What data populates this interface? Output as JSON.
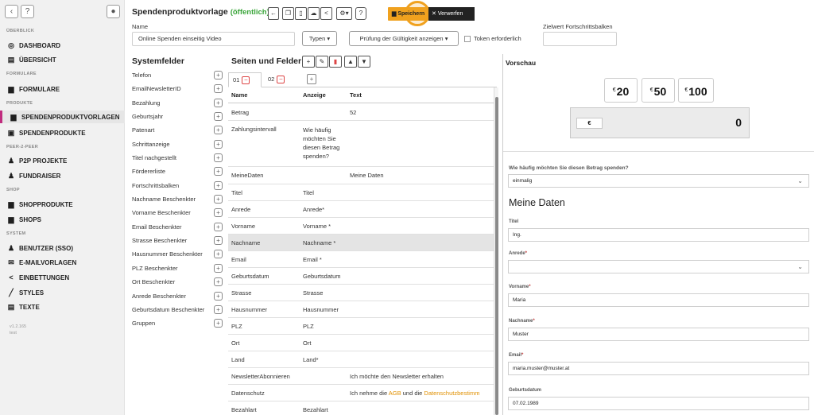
{
  "sidebar": {
    "sections": [
      {
        "label": "ÜBERBLICK"
      },
      {
        "label": "FORMULARE"
      },
      {
        "label": "PRODUKTE"
      },
      {
        "label": "PEER-2-PEER"
      },
      {
        "label": "SHOP"
      },
      {
        "label": "SYSTEM"
      }
    ],
    "items": [
      {
        "label": "DASHBOARD",
        "icon": "dashboard-icon"
      },
      {
        "label": "ÜBERSICHT",
        "icon": "overview-icon"
      },
      {
        "label": "FORMULARE",
        "icon": "form-icon"
      },
      {
        "label": "SPENDENPRODUKTVORLAGEN",
        "icon": "template-icon"
      },
      {
        "label": "SPENDENPRODUKTE",
        "icon": "gift-icon"
      },
      {
        "label": "P2P PROJEKTE",
        "icon": "users-icon"
      },
      {
        "label": "FUNDRAISER",
        "icon": "group-icon"
      },
      {
        "label": "SHOPPRODUKTE",
        "icon": "shop-product-icon"
      },
      {
        "label": "SHOPS",
        "icon": "shop-icon"
      },
      {
        "label": "BENUTZER (SSO)",
        "icon": "group-icon"
      },
      {
        "label": "E-MAILVORLAGEN",
        "icon": "mail-icon"
      },
      {
        "label": "EINBETTUNGEN",
        "icon": "share-icon"
      },
      {
        "label": "STYLES",
        "icon": "pen-icon"
      },
      {
        "label": "TEXTE",
        "icon": "text-icon"
      }
    ],
    "version": "v1.2.165",
    "env": "test"
  },
  "header": {
    "title": "Spendenproduktvorlage",
    "status": "(öffentlich)",
    "save_label": "Speichern",
    "discard_label": "Verwerfen"
  },
  "form": {
    "name_label": "Name",
    "name_value": "Online Spenden einseitig Video",
    "type_select": "Typen",
    "validation_select": "Prüfung der Gültigkeit anzeigen",
    "token_label": "Token erforderlich",
    "goal_label": "Zielwert Fortschrittsbalken",
    "goal_value": ""
  },
  "systemfelder": {
    "title": "Systemfelder",
    "items": [
      "Telefon",
      "EmailNewsletterID",
      "Bezahlung",
      "Geburtsjahr",
      "Patenart",
      "Schrittanzeige",
      "Titel nachgestellt",
      "Fördererliste",
      "Fortschrittsbalken",
      "Nachname Beschenkter",
      "Vorname Beschenkter",
      "Email Beschenkter",
      "Strasse Beschenkter",
      "Hausnummer Beschenkter",
      "PLZ Beschenkter",
      "Ort Beschenkter",
      "Anrede Beschenkter",
      "Geburtsdatum Beschenkter",
      "Gruppen"
    ]
  },
  "seiten": {
    "title": "Seiten und Felder",
    "tabs": [
      "01",
      "02"
    ],
    "headers": [
      "Name",
      "Anzeige",
      "Text"
    ],
    "rows": [
      {
        "name": "Betrag",
        "anzeige": "",
        "text": "52"
      },
      {
        "name": "Zahlungsintervall",
        "anzeige": "Wie häufig möchten Sie diesen Betrag spenden?",
        "text": ""
      },
      {
        "name": "MeineDaten",
        "anzeige": "",
        "text": "Meine Daten"
      },
      {
        "name": "Titel",
        "anzeige": "Titel",
        "text": ""
      },
      {
        "name": "Anrede",
        "anzeige": "Anrede*",
        "text": ""
      },
      {
        "name": "Vorname",
        "anzeige": "Vorname *",
        "text": ""
      },
      {
        "name": "Nachname",
        "anzeige": "Nachname *",
        "text": ""
      },
      {
        "name": "Email",
        "anzeige": "Email *",
        "text": ""
      },
      {
        "name": "Geburtsdatum",
        "anzeige": "Geburtsdatum",
        "text": ""
      },
      {
        "name": "Strasse",
        "anzeige": "Strasse",
        "text": ""
      },
      {
        "name": "Hausnummer",
        "anzeige": "Hausnummer",
        "text": ""
      },
      {
        "name": "PLZ",
        "anzeige": "PLZ",
        "text": ""
      },
      {
        "name": "Ort",
        "anzeige": "Ort",
        "text": ""
      },
      {
        "name": "Land",
        "anzeige": "Land*",
        "text": ""
      },
      {
        "name": "NewsletterAbonnieren",
        "anzeige": "",
        "text": "Ich möchte den Newsletter erhalten"
      },
      {
        "name": "Datenschutz",
        "anzeige": "",
        "text_a": "Ich nehme die ",
        "text_link1": "AGB",
        "text_b": " und die ",
        "text_link2": "Datenschutzbestimm"
      },
      {
        "name": "Bezahlart",
        "anzeige": "Bezahlart",
        "text": ""
      }
    ]
  },
  "preview": {
    "title": "Vorschau",
    "amounts": [
      {
        "currency": "€",
        "value": "20"
      },
      {
        "currency": "€",
        "value": "50"
      },
      {
        "currency": "€",
        "value": "100"
      }
    ],
    "currency_box": "€",
    "total": "0",
    "frequency_question": "Wie häufig möchten Sie diesen Betrag spenden?",
    "frequency_value": "einmalig",
    "section_title": "Meine Daten",
    "titel_label": "Titel",
    "titel_value": "Ing.",
    "anrede_label": "Anrede",
    "anrede_value": "",
    "vorname_label": "Vorname",
    "vorname_value": "Maria",
    "nachname_label": "Nachname",
    "nachname_value": "Muster",
    "email_label": "Email",
    "email_value": "maria.muster@muster.at",
    "geburtsdatum_label": "Geburtsdatum",
    "geburtsdatum_value": "07.02.1989",
    "required_mark": "*"
  },
  "colors": {
    "accent": "#f0a11e",
    "active_bar": "#c02b7e",
    "public_status": "#3aa53a",
    "delete": "#dd4444"
  }
}
